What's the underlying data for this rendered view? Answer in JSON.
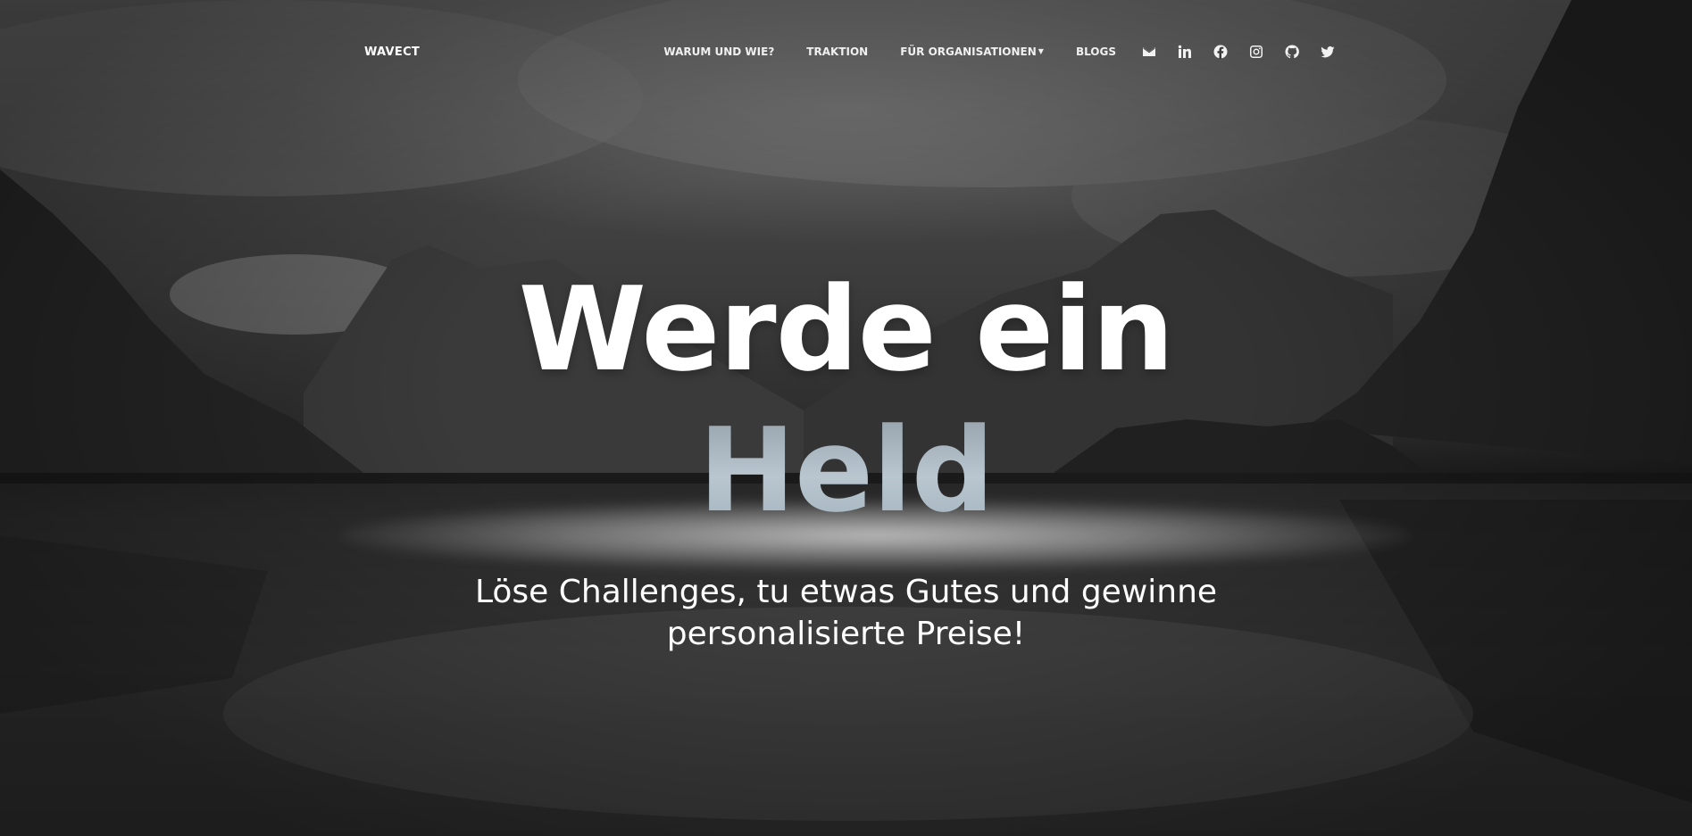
{
  "brand": "WAVECT",
  "nav": {
    "items": [
      {
        "label": "WARUM UND WIE?"
      },
      {
        "label": "TRAKTION"
      },
      {
        "label": "FÜR ORGANISATIONEN",
        "has_dropdown": true
      },
      {
        "label": "BLOGS"
      }
    ],
    "social": [
      "envelope-icon",
      "linkedin-icon",
      "facebook-icon",
      "instagram-icon",
      "github-icon",
      "twitter-icon"
    ]
  },
  "hero": {
    "headline_line1": "Werde ein",
    "headline_line2": "Held",
    "subline_line1": "Löse Challenges, tu etwas Gutes und gewinne",
    "subline_line2": "personalisierte Preise!"
  },
  "colors": {
    "text": "#ffffff",
    "headline_accent": "#aab8c2"
  }
}
